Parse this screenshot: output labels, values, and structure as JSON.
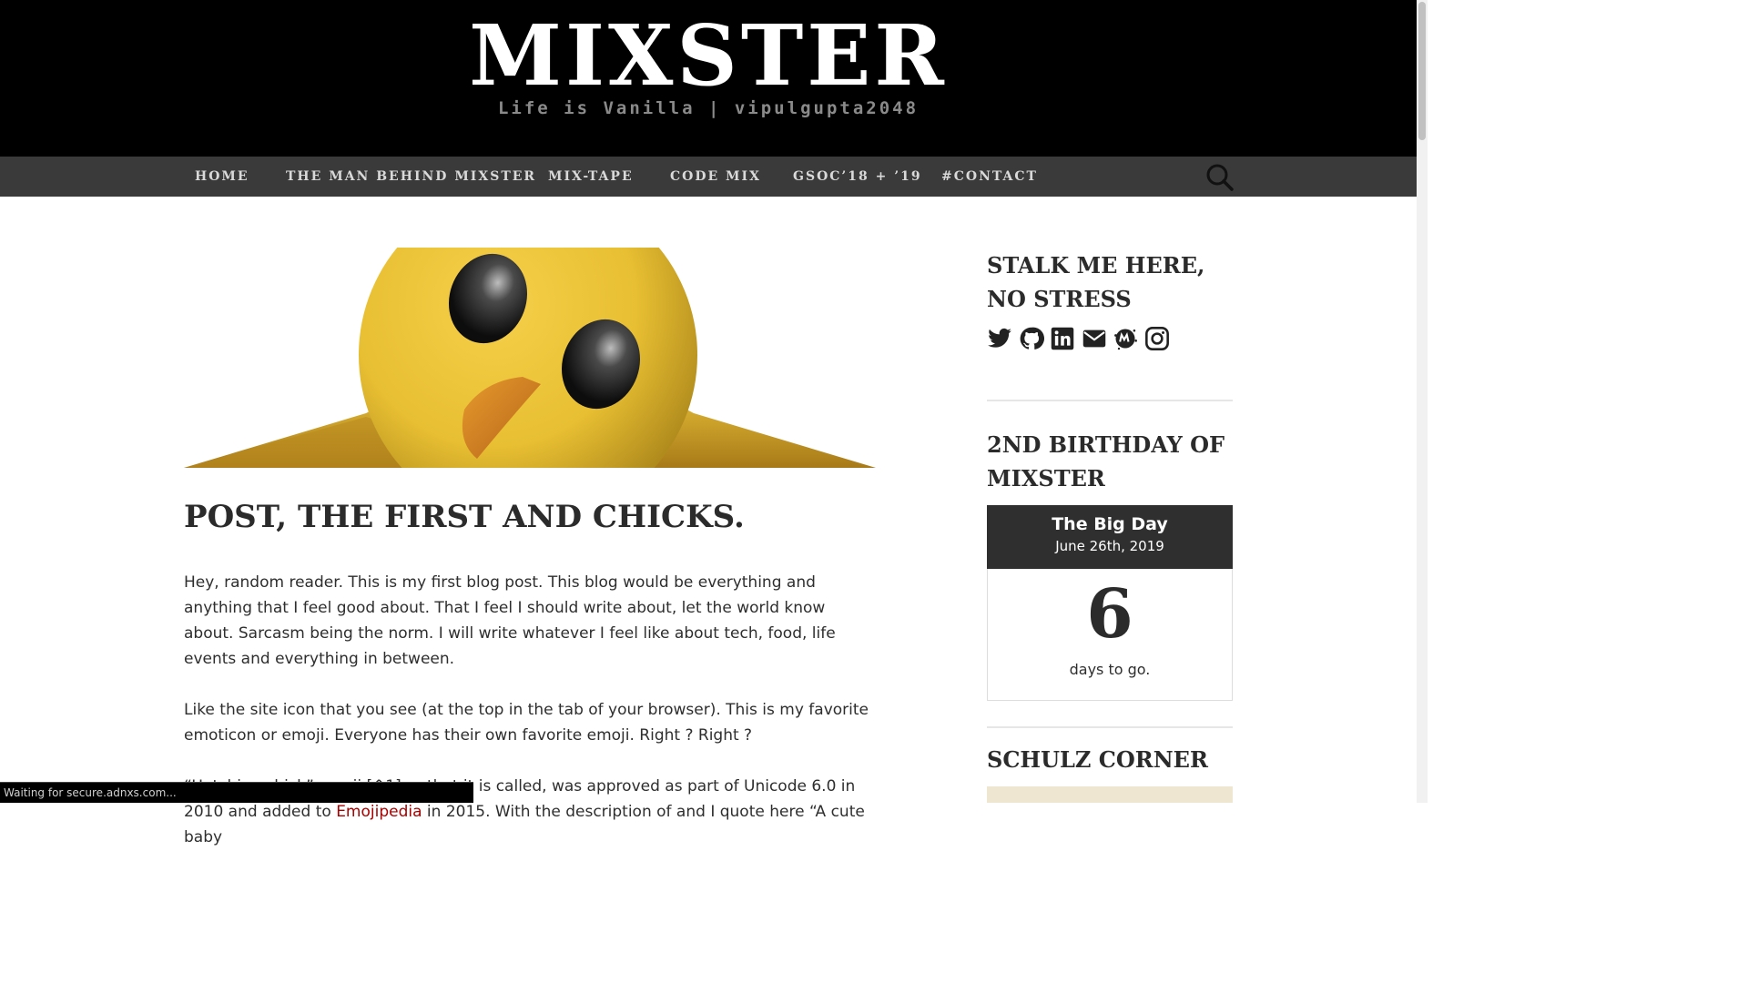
{
  "site": {
    "title": "MIXSTER",
    "description": "Life is Vanilla | vipulgupta2048"
  },
  "nav": {
    "items": [
      {
        "label": "HOME"
      },
      {
        "label": "THE MAN BEHIND MIXSTER"
      },
      {
        "label": "MIX-TAPE"
      },
      {
        "label": "CODE MIX"
      },
      {
        "label": "GSOC’18 + ’19"
      },
      {
        "label": "#CONTACT"
      }
    ],
    "search_icon": "search-icon"
  },
  "post": {
    "hero_image": "hatching-chick-emoji",
    "title": "POST, THE FIRST AND CHICKS.",
    "paragraphs": [
      "Hey, random reader. This is my first blog post. This blog would be everything and anything that I feel good about. That I feel I should write about, let the world know about. Sarcasm being the norm. I will write whatever I feel like about tech, food, life events and everything in between.",
      "Like the site icon that you see (at the top in the tab of your browser). This is my favorite emoticon or emoji. Everyone has their own favorite emoji. Right ? Right ?"
    ],
    "para3_start": "“Hatching chick” emoji [^1] or that it is called, was approved as part of Unicode 6.0 in 2010 and",
    "para3_pre": "added to ",
    "para3_link": "Emojipedia",
    "para3_mid": " in 2015. With the description of and I quote here “A cute baby"
  },
  "sidebar": {
    "social_title": "STALK ME HERE, NO STRESS",
    "social_icons": [
      "twitter-icon",
      "github-icon",
      "linkedin-icon",
      "mail-icon",
      "meetup-icon",
      "instagram-icon"
    ],
    "birthday_title": "2ND BIRTHDAY OF MIXSTER",
    "countdown": {
      "event": "The Big Day",
      "date": "June 26th, 2019",
      "number": "6",
      "label": "days to go."
    },
    "schulz_title": "SCHULZ CORNER"
  },
  "status_bar": {
    "text": "Waiting for secure.adnxs.com..."
  },
  "colors": {
    "header_bg": "#000000",
    "nav_bg": "#3a3a3a",
    "countdown_head": "#2f2f2f",
    "link": "#aa0000"
  }
}
